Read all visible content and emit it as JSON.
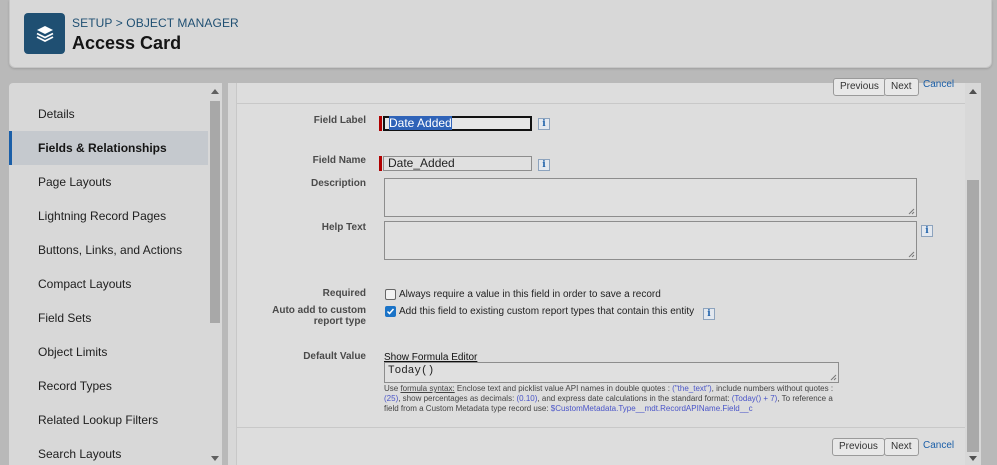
{
  "header": {
    "breadcrumb_setup": "SETUP",
    "breadcrumb_sep": ">",
    "breadcrumb_object_manager": "OBJECT MANAGER",
    "title": "Access Card",
    "icon": "layers-icon"
  },
  "sidebar": {
    "items": [
      {
        "label": "Details",
        "active": false
      },
      {
        "label": "Fields & Relationships",
        "active": true
      },
      {
        "label": "Page Layouts",
        "active": false
      },
      {
        "label": "Lightning Record Pages",
        "active": false
      },
      {
        "label": "Buttons, Links, and Actions",
        "active": false
      },
      {
        "label": "Compact Layouts",
        "active": false
      },
      {
        "label": "Field Sets",
        "active": false
      },
      {
        "label": "Object Limits",
        "active": false
      },
      {
        "label": "Record Types",
        "active": false
      },
      {
        "label": "Related Lookup Filters",
        "active": false
      },
      {
        "label": "Search Layouts",
        "active": false
      }
    ]
  },
  "nav": {
    "previous": "Previous",
    "next": "Next",
    "cancel": "Cancel"
  },
  "form": {
    "field_label": {
      "label": "Field Label",
      "value": "Date Added"
    },
    "field_name": {
      "label": "Field Name",
      "value": "Date_Added"
    },
    "description": {
      "label": "Description",
      "value": ""
    },
    "help_text": {
      "label": "Help Text",
      "value": ""
    },
    "required": {
      "label": "Required",
      "checkbox_text": "Always require a value in this field in order to save a record",
      "checked": false
    },
    "auto_add": {
      "label_line1": "Auto add to custom",
      "label_line2": "report type",
      "checkbox_text": "Add this field to existing custom report types that contain this entity",
      "checked": true
    },
    "default_value": {
      "label": "Default Value",
      "formula_link": "Show Formula Editor",
      "value": "Today()"
    },
    "help": {
      "use": "Use ",
      "formula_syntax": "formula syntax:",
      "t1": " Enclose text and picklist value API names in double quotes : ",
      "ex1": "(\"the_text\")",
      "t2": ", include numbers without quotes : ",
      "ex2": "(25)",
      "t3": ", show percentages as decimals: ",
      "ex3": "(0.10)",
      "t4": ", and express date calculations in the standard format: ",
      "ex4": "(Today() + 7)",
      "t5": ", To reference a field from a Custom Metadata type record use: ",
      "ex5": "$CustomMetadata.Type__mdt.RecordAPIName.Field__c"
    }
  },
  "colors": {
    "accent": "#1b5fa8",
    "brand_icon_bg": "#1f4f72",
    "required_bar": "#b00000"
  }
}
